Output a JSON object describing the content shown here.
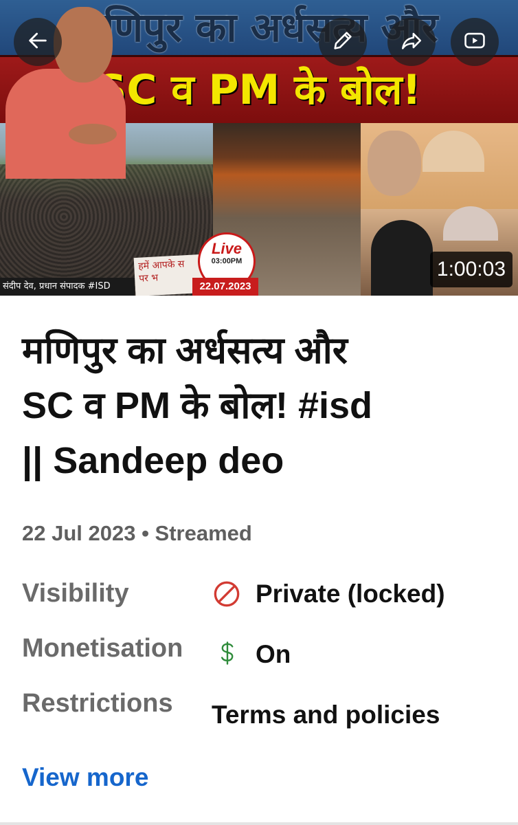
{
  "thumbnail": {
    "banner_top": "मणिपुर का अर्धसत्य और",
    "banner_red": "SC व PM के बोल!",
    "caption": "संदीप देव, प्रधान संपादक #ISD",
    "sign_text": "हमें आपके स\nपर भ",
    "live_word": "Live",
    "live_time": "03:00PM",
    "date": "22.07.2023",
    "duration": "1:00:03"
  },
  "overlay": {
    "back_icon": "arrow-left-icon",
    "edit_icon": "pencil-icon",
    "share_icon": "share-arrow-icon",
    "watch_icon": "youtube-play-icon"
  },
  "video": {
    "title_lines": [
      "मणिपुर का अर्धसत्य और",
      "SC व PM के बोल! #isd",
      "|| Sandeep deo"
    ],
    "meta": "22 Jul 2023 • Streamed",
    "visibility_label": "Visibility",
    "visibility_value": "Private (locked)",
    "visibility_icon": "no-entry-icon",
    "monetisation_label": "Monetisation",
    "monetisation_value": "On",
    "monetisation_icon": "dollar-icon",
    "restrictions_label": "Restrictions",
    "restrictions_value": "Terms and policies",
    "view_more": "View more"
  },
  "colors": {
    "link": "#1666cc",
    "private_icon": "#d23b33",
    "money_icon": "#2e8b3a"
  }
}
